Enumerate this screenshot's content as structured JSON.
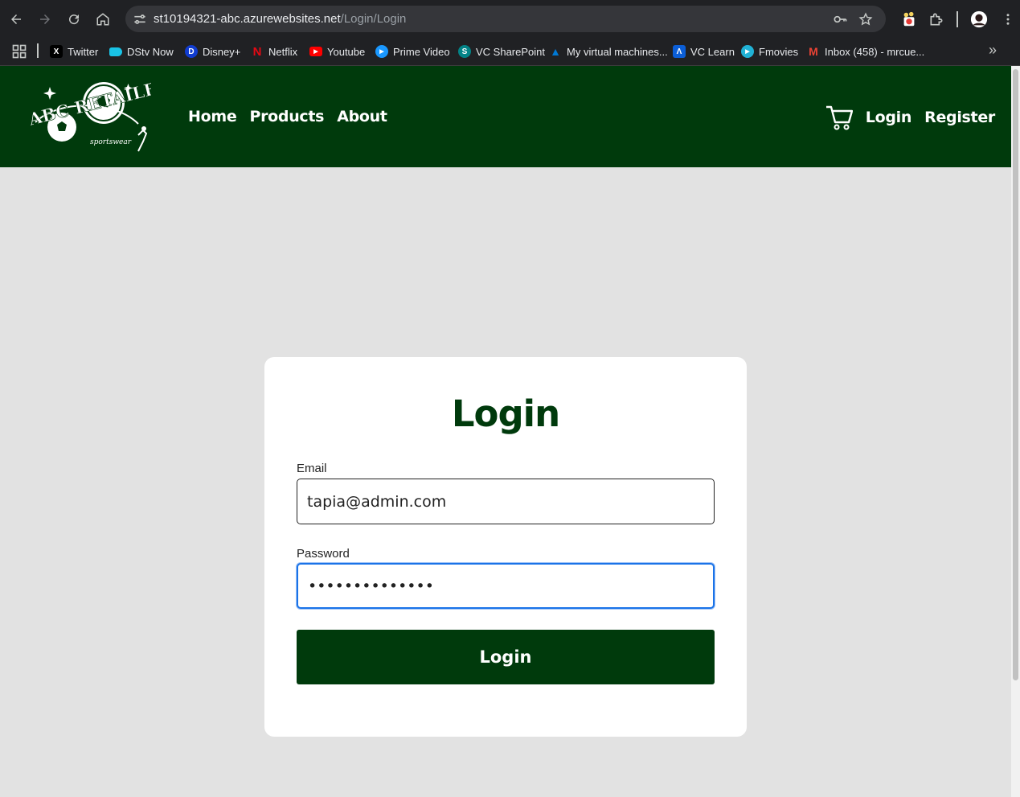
{
  "browser": {
    "url_host": "st10194321-abc.azurewebsites.net",
    "url_path": "/Login/Login",
    "bookmarks": [
      {
        "label": "Twitter",
        "icon": "x-icon",
        "color": "#000000"
      },
      {
        "label": "DStv Now",
        "icon": "dstv-icon",
        "color": "#19c3e6"
      },
      {
        "label": "Disney+",
        "icon": "disney-icon",
        "color": "#113ccf"
      },
      {
        "label": "Netflix",
        "icon": "netflix-icon",
        "color": "#e50914"
      },
      {
        "label": "Youtube",
        "icon": "youtube-icon",
        "color": "#ff0000"
      },
      {
        "label": "Prime Video",
        "icon": "prime-video-icon",
        "color": "#1a98ff"
      },
      {
        "label": "VC SharePoint",
        "icon": "sharepoint-icon",
        "color": "#038387"
      },
      {
        "label": "My virtual machines...",
        "icon": "azure-icon",
        "color": "#0078d4"
      },
      {
        "label": "VC Learn",
        "icon": "vc-learn-icon",
        "color": "#0b5ed7"
      },
      {
        "label": "Fmovies",
        "icon": "fmovies-icon",
        "color": "#20b2d6"
      },
      {
        "label": "Inbox (458) - mrcue...",
        "icon": "gmail-icon",
        "color": "#ea4335"
      }
    ]
  },
  "site": {
    "brand_color": "#003a0c",
    "logo_text": "ABC RETAILERS",
    "logo_subtext": "sportswear",
    "nav": {
      "home": "Home",
      "products": "Products",
      "about": "About"
    },
    "account": {
      "login": "Login",
      "register": "Register"
    }
  },
  "login_form": {
    "title": "Login",
    "email_label": "Email",
    "email_value": "tapia@admin.com",
    "password_label": "Password",
    "password_value": "••••••••••••••",
    "submit_label": "Login"
  }
}
